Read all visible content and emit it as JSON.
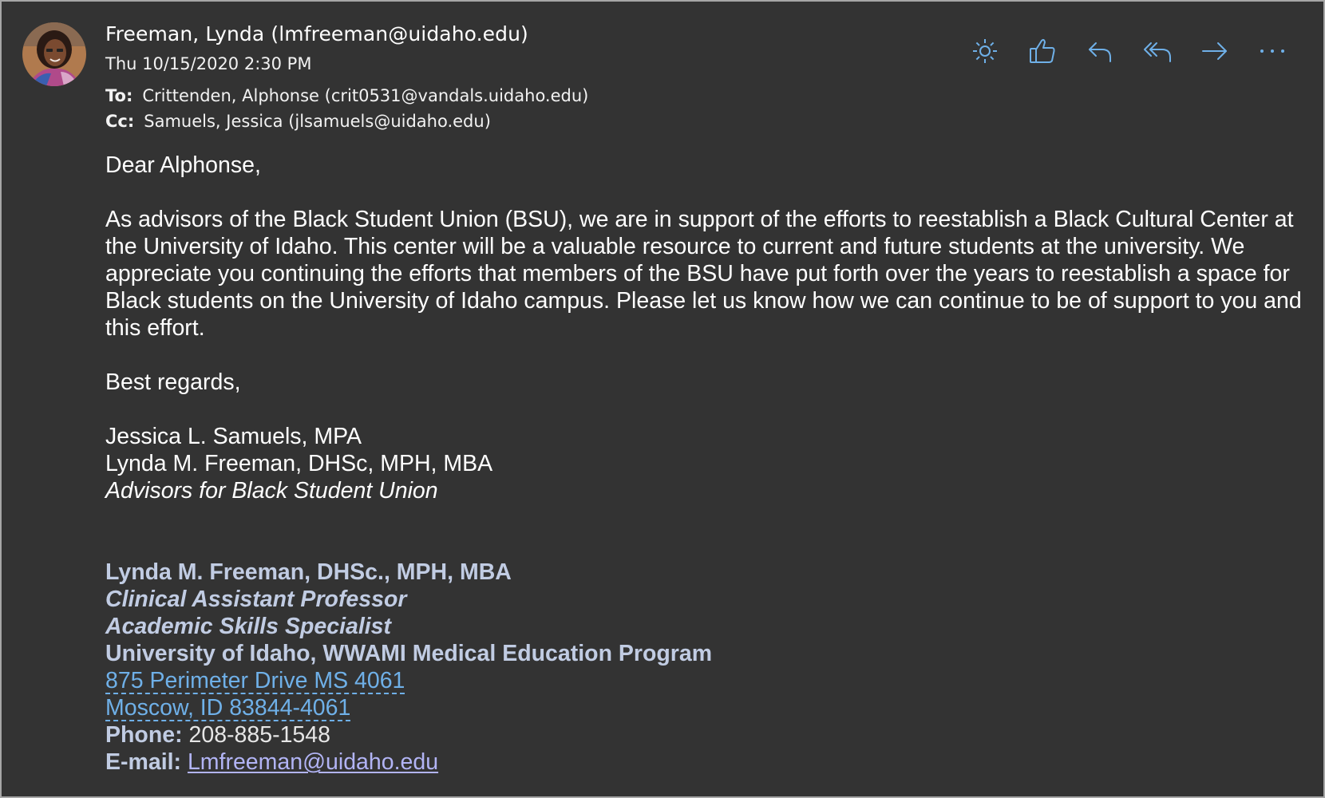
{
  "message": {
    "sender": "Freeman, Lynda (lmfreeman@uidaho.edu)",
    "date": "Thu 10/15/2020 2:30 PM",
    "to_label": "To:",
    "to": "Crittenden, Alphonse (crit0531@vandals.uidaho.edu)",
    "cc_label": "Cc:",
    "cc": "Samuels, Jessica (jlsamuels@uidaho.edu)"
  },
  "toolbar": {
    "icons": [
      "sun-icon",
      "thumbs-up-icon",
      "reply-icon",
      "reply-all-icon",
      "forward-icon",
      "more-icon"
    ],
    "icon_color": "#6fb0e8"
  },
  "body": {
    "greeting": "Dear Alphonse,",
    "paragraph": "As advisors of the Black Student Union (BSU), we are in support of the efforts to reestablish a Black Cultural Center at the University of Idaho. This center will be a valuable resource to current and future students at the university.  We appreciate you continuing the efforts that members of the BSU have put forth over the years to reestablish a space for Black students on the University of Idaho campus. Please let us know how we can continue to be of support to you and this effort.",
    "closing": "Best regards,",
    "signer_1": "Jessica L. Samuels, MPA",
    "signer_2": "Lynda M. Freeman, DHSc, MPH, MBA",
    "signer_role": "Advisors for Black Student Union"
  },
  "signature": {
    "name": "Lynda M. Freeman, DHSc., MPH, MBA",
    "title_1": "Clinical Assistant Professor",
    "title_2": "Academic Skills Specialist",
    "org": "University of Idaho, WWAMI Medical Education Program",
    "address_1": "875 Perimeter Drive MS 4061",
    "address_2": "Moscow, ID 83844-4061",
    "phone_label": "Phone:",
    "phone": "208-885-1548",
    "email_label": "E-mail:",
    "email": "Lmfreeman@uidaho.edu"
  },
  "colors": {
    "background": "#333333",
    "signature_text": "#c1cce3",
    "link": "#6fb0e8",
    "email_link": "#b2b4f5"
  }
}
